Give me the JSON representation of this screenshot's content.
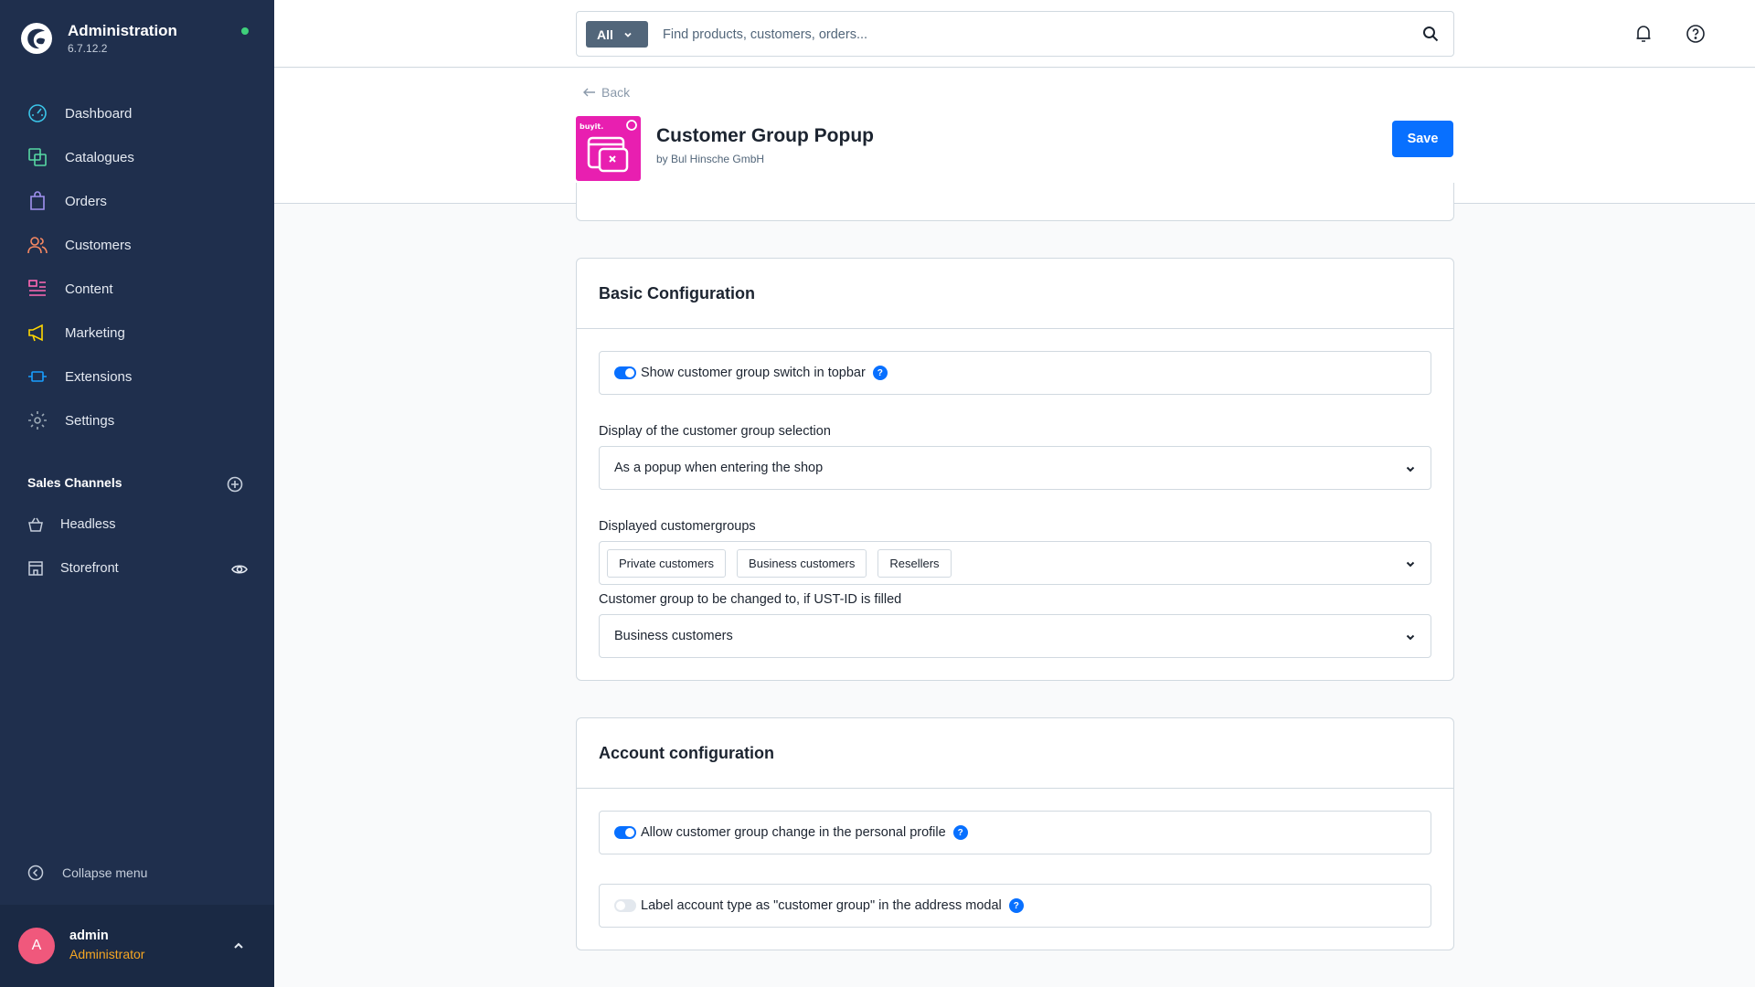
{
  "app": {
    "title": "Administration",
    "version": "6.7.12.2"
  },
  "sidebar": {
    "items": [
      {
        "label": "Dashboard",
        "icon": "dashboard-icon",
        "color": "#3bc4e8"
      },
      {
        "label": "Catalogues",
        "icon": "catalogue-icon",
        "color": "#57d9a3"
      },
      {
        "label": "Orders",
        "icon": "orders-icon",
        "color": "#a092f0"
      },
      {
        "label": "Customers",
        "icon": "customers-icon",
        "color": "#f88962"
      },
      {
        "label": "Content",
        "icon": "content-icon",
        "color": "#ff68b4"
      },
      {
        "label": "Marketing",
        "icon": "marketing-icon",
        "color": "#ffd700"
      },
      {
        "label": "Extensions",
        "icon": "extensions-icon",
        "color": "#189eff"
      },
      {
        "label": "Settings",
        "icon": "settings-icon",
        "color": "#9aa8b5"
      }
    ],
    "sales_channels": {
      "heading": "Sales Channels",
      "items": [
        {
          "label": "Headless",
          "icon": "basket-icon"
        },
        {
          "label": "Storefront",
          "icon": "storefront-icon"
        }
      ]
    },
    "collapse_label": "Collapse menu",
    "user": {
      "initial": "A",
      "name": "admin",
      "role": "Administrator"
    }
  },
  "topbar": {
    "search_type": "All",
    "search_placeholder": "Find products, customers, orders..."
  },
  "smartbar": {
    "back_label": "Back",
    "title": "Customer Group Popup",
    "author": "by Bul Hinsche GmbH",
    "save_label": "Save",
    "icon_brand_text": "buyit."
  },
  "basic_config": {
    "title": "Basic Configuration",
    "topbar_switch": {
      "label": "Show customer group switch in topbar",
      "enabled": true
    },
    "display_selection": {
      "label": "Display of the customer group selection",
      "value": "As a popup when entering the shop"
    },
    "displayed_groups": {
      "label": "Displayed customergroups",
      "chips": [
        "Private customers",
        "Business customers",
        "Resellers"
      ]
    },
    "ust_id_group": {
      "label": "Customer group to be changed to, if UST-ID is filled",
      "value": "Business customers"
    }
  },
  "account_config": {
    "title": "Account configuration",
    "profile_change": {
      "label": "Allow customer group change in the personal profile",
      "enabled": true
    },
    "label_account_type": {
      "label": "Label account type as \"customer group\" in the address modal",
      "enabled": false
    }
  },
  "colors": {
    "sidebar_bg": "#1f2f4d",
    "accent": "#0870ff",
    "plugin_icon": "#e81fb0",
    "user_role": "#f5a623",
    "avatar": "#f0587c"
  }
}
